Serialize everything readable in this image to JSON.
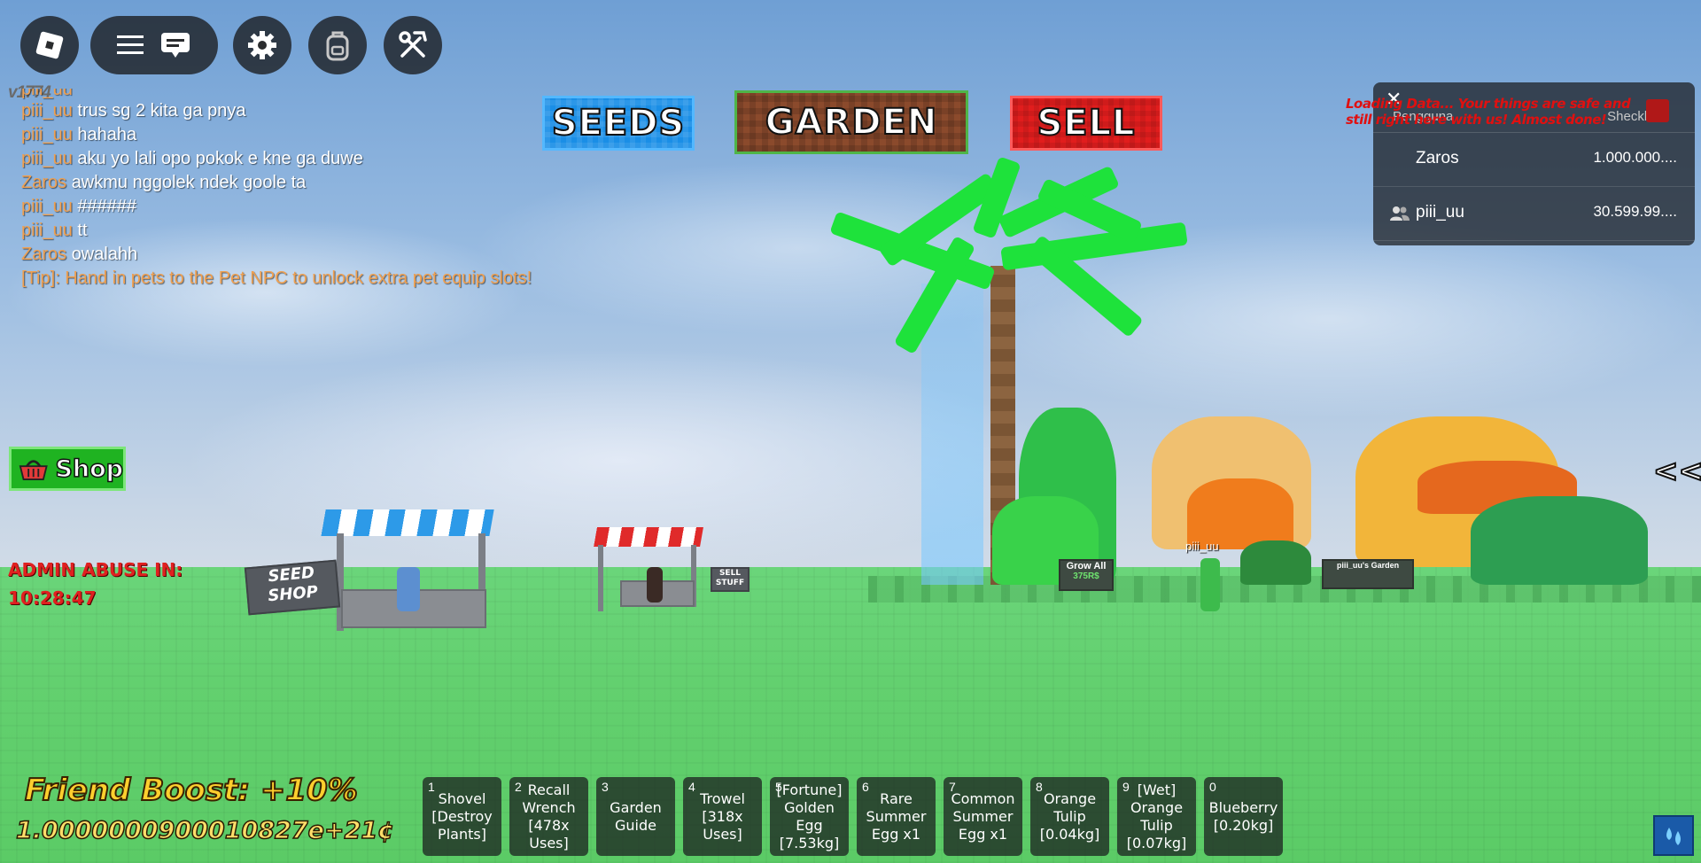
{
  "topbar": {
    "buttons": [
      "roblox-menu",
      "hamburger-menu",
      "chat",
      "settings",
      "backpack",
      "build-tools"
    ]
  },
  "version": "v1774",
  "chat": {
    "clipped_line": "piii_uu",
    "lines": [
      {
        "user": "piii_uu",
        "text": "trus sg 2 kita ga pnya"
      },
      {
        "user": "piii_uu",
        "text": "hahaha"
      },
      {
        "user": "piii_uu",
        "text": "aku yo lali opo pokok e kne ga duwe"
      },
      {
        "user": "Zaros",
        "text": "awkmu nggolek ndek goole ta"
      },
      {
        "user": "piii_uu",
        "text": "######"
      },
      {
        "user": "piii_uu",
        "text": "tt"
      },
      {
        "user": "Zaros",
        "text": "owalahh"
      }
    ],
    "tip": "[Tip]: Hand in pets to the Pet NPC to unlock extra pet equip slots!"
  },
  "nav": {
    "seeds": "SEEDS",
    "garden": "GARDEN",
    "sell": "SELL"
  },
  "loading_text": "Loading Data... Your things are safe and still right here with us! Almost done!",
  "leaderboard": {
    "col_user": "Pengguna",
    "col_stat": "Sheckles",
    "rows": [
      {
        "name": "Zaros",
        "value": "1.000.000...."
      },
      {
        "name": "piii_uu",
        "value": "30.599.99...."
      }
    ]
  },
  "shop_label": "Shop",
  "admin": {
    "label": "ADMIN ABUSE IN:",
    "timer": "10:28:47"
  },
  "collapse_label": "<<",
  "world_signs": {
    "seed_shop": "SEED SHOP",
    "sell_stuff": "SELL STUFF",
    "grow_all": "Grow All",
    "grow_all_price": "375R$",
    "player_tag": "piii_uu",
    "garden_sign": "piii_uu's Garden"
  },
  "boost": "Friend Boost: +10%",
  "money": "1.0000000900010827e+21¢",
  "hotbar": [
    {
      "num": "1",
      "label": "Shovel [Destroy Plants]"
    },
    {
      "num": "2",
      "label": "Recall Wrench [478x Uses]"
    },
    {
      "num": "3",
      "label": "Garden Guide"
    },
    {
      "num": "4",
      "label": "Trowel [318x Uses]"
    },
    {
      "num": "5",
      "label": "[Fortune] Golden Egg [7.53kg]"
    },
    {
      "num": "6",
      "label": "Rare Summer Egg x1"
    },
    {
      "num": "7",
      "label": "Common Summer Egg x1"
    },
    {
      "num": "8",
      "label": "Orange Tulip [0.04kg]"
    },
    {
      "num": "9",
      "label": "[Wet] Orange Tulip [0.07kg]"
    },
    {
      "num": "0",
      "label": "Blueberry [0.20kg]"
    }
  ],
  "colors": {
    "chat_user": "#f0a050",
    "seeds": "#1a8ee6",
    "garden": "#8b4a2c",
    "sell": "#e11d1d",
    "shop": "#1fb321",
    "admin": "#e02020",
    "boost": "#ffcf2e"
  }
}
